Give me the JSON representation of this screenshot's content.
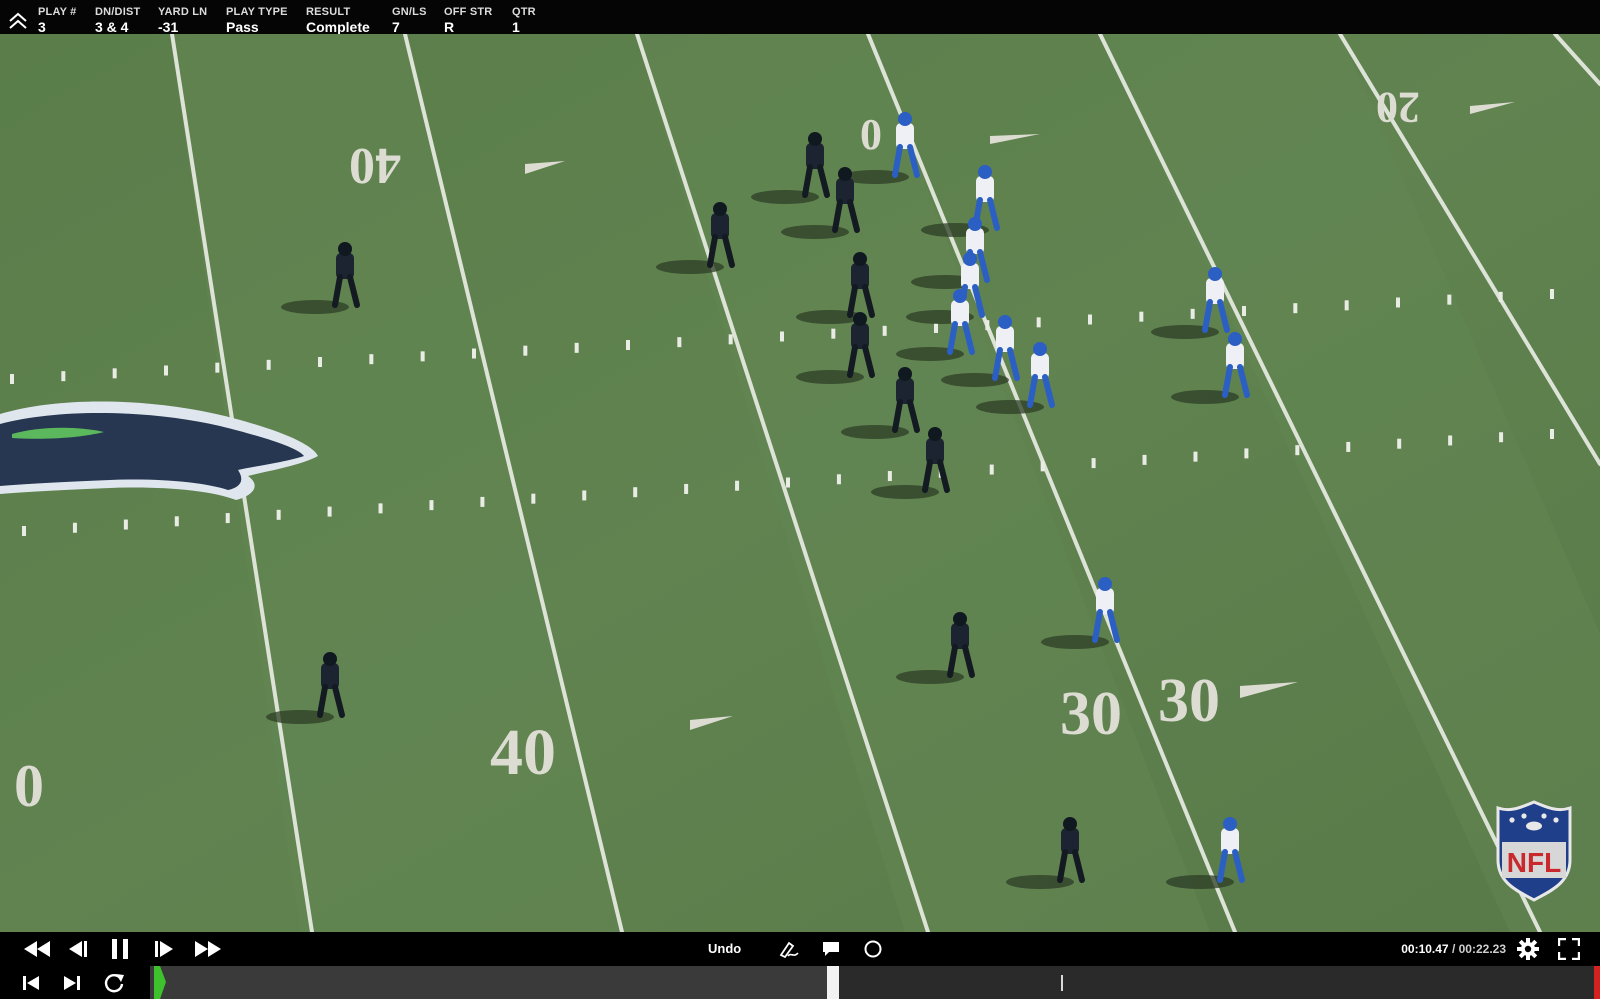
{
  "info_bar": {
    "fields": [
      {
        "label": "PLAY #",
        "value": "3"
      },
      {
        "label": "DN/DIST",
        "value": "3 & 4"
      },
      {
        "label": "YARD LN",
        "value": "-31"
      },
      {
        "label": "PLAY TYPE",
        "value": "Pass"
      },
      {
        "label": "RESULT",
        "value": "Complete"
      },
      {
        "label": "GN/LS",
        "value": "7"
      },
      {
        "label": "OFF STR",
        "value": "R"
      },
      {
        "label": "QTR",
        "value": "1"
      }
    ],
    "collapse_icon": "chevron-double-up-icon"
  },
  "video": {
    "yard_numbers": [
      "40",
      "40",
      "30",
      "30",
      "20",
      "0",
      "0"
    ],
    "watermark": "NFL",
    "colors": {
      "field": "#5d7f4d",
      "offense_jersey": "#eef0f6",
      "offense_accent": "#2b5fc4",
      "defense_jersey": "#1b2430"
    }
  },
  "controls": {
    "undo_label": "Undo",
    "current_time": "00:10.47",
    "separator": " / ",
    "total_time": "00:22.23",
    "progress": 0.471,
    "icons": [
      "rewind-icon",
      "step-back-icon",
      "pause-icon",
      "step-forward-icon",
      "fast-forward-icon",
      "pen-icon",
      "comment-icon",
      "circle-tool-icon",
      "gear-icon",
      "fullscreen-icon",
      "skip-start-icon",
      "skip-end-icon",
      "replay-icon"
    ]
  }
}
